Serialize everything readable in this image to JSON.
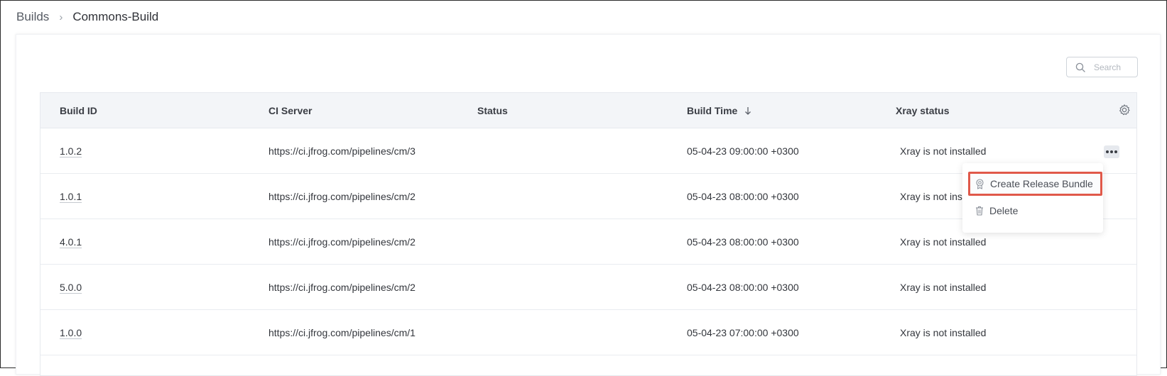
{
  "breadcrumb": {
    "parent": "Builds",
    "separator": "›",
    "current": "Commons-Build"
  },
  "search": {
    "placeholder": "Search",
    "icon": "search-icon"
  },
  "table": {
    "columns": [
      "Build ID",
      "CI Server",
      "Status",
      "Build Time",
      "Xray status"
    ],
    "sort_column": "Build Time",
    "sort_direction": "descending",
    "settings_icon": "gear-icon",
    "rows": [
      {
        "build_id": "1.0.2",
        "ci_server": "https://ci.jfrog.com/pipelines/cm/3",
        "status": "",
        "build_time": "05-04-23 09:00:00 +0300",
        "xray_status": "Xray is not installed"
      },
      {
        "build_id": "1.0.1",
        "ci_server": "https://ci.jfrog.com/pipelines/cm/2",
        "status": "",
        "build_time": "05-04-23 08:00:00 +0300",
        "xray_status": "Xray is not ins"
      },
      {
        "build_id": "4.0.1",
        "ci_server": "https://ci.jfrog.com/pipelines/cm/2",
        "status": "",
        "build_time": "05-04-23 08:00:00 +0300",
        "xray_status": "Xray is not installed"
      },
      {
        "build_id": "5.0.0",
        "ci_server": "https://ci.jfrog.com/pipelines/cm/2",
        "status": "",
        "build_time": "05-04-23 08:00:00 +0300",
        "xray_status": "Xray is not installed"
      },
      {
        "build_id": "1.0.0",
        "ci_server": "https://ci.jfrog.com/pipelines/cm/1",
        "status": "",
        "build_time": "05-04-23 07:00:00 +0300",
        "xray_status": "Xray is not installed"
      }
    ]
  },
  "context_menu": {
    "items": [
      {
        "label": "Create Release Bundle",
        "icon": "release-bundle-icon"
      },
      {
        "label": "Delete",
        "icon": "trash-icon"
      }
    ],
    "highlight_color": "#e0594a"
  }
}
